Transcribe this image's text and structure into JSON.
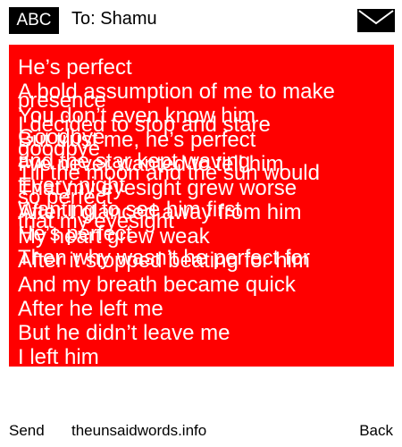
{
  "header": {
    "badge": "ABC",
    "to_line": "To: Shamu",
    "envelope_icon": "envelope-icon"
  },
  "message": {
    "background_color": "#ff0000",
    "text_color": "#ffffff",
    "lines_main": [
      "He’s perfect",
      "A bold assumption of me to make",
      "You don’t even know him",
      "But trust me, he’s perfect",
      "I’ve never wanted to tell him",
      "That my eyesight grew worse",
      "After I glanced away from him",
      "My heart grew weak",
      "After it stopped beating for him",
      "And my breath became quick",
      "After he left me",
      "But he didn’t leave me",
      "I left him"
    ],
    "lines_overlap_a": [
      "presence",
      "I decided to stop and stare",
      "goodbye",
      "Till the moon and the sun would",
      "so perfect",
      "that my eyesight"
    ],
    "lines_overlap_b": [
      "Goodbye",
      "and the star kept waving",
      "Every night",
      "Wanting to see him first",
      "He’s perfect",
      "Then why wasn’t he perfect for"
    ]
  },
  "footer": {
    "send": "Send",
    "site": "theunsaidwords.info",
    "back": "Back"
  }
}
